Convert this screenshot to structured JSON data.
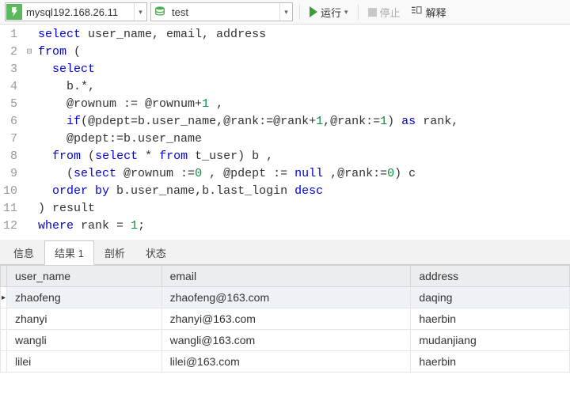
{
  "toolbar": {
    "connection": "mysql192.168.26.11",
    "database": "test",
    "run_label": "运行",
    "stop_label": "停止",
    "explain_label": "解释"
  },
  "editor": {
    "lines": [
      [
        {
          "t": "select",
          "c": "kw"
        },
        {
          "t": " user_name, email, address",
          "c": ""
        }
      ],
      [
        {
          "t": "from",
          "c": "kw"
        },
        {
          "t": " (",
          "c": ""
        }
      ],
      [
        {
          "t": "  ",
          "c": ""
        },
        {
          "t": "select",
          "c": "kw"
        }
      ],
      [
        {
          "t": "    b.*,",
          "c": ""
        }
      ],
      [
        {
          "t": "    @rownum := @rownum+",
          "c": ""
        },
        {
          "t": "1",
          "c": "num"
        },
        {
          "t": " ,",
          "c": ""
        }
      ],
      [
        {
          "t": "    ",
          "c": ""
        },
        {
          "t": "if",
          "c": "kw"
        },
        {
          "t": "(@pdept=b.user_name,@rank:=@rank+",
          "c": ""
        },
        {
          "t": "1",
          "c": "num"
        },
        {
          "t": ",@rank:=",
          "c": ""
        },
        {
          "t": "1",
          "c": "num"
        },
        {
          "t": ") ",
          "c": ""
        },
        {
          "t": "as",
          "c": "kw"
        },
        {
          "t": " rank,",
          "c": ""
        }
      ],
      [
        {
          "t": "    @pdept:=b.user_name",
          "c": ""
        }
      ],
      [
        {
          "t": "  ",
          "c": ""
        },
        {
          "t": "from",
          "c": "kw"
        },
        {
          "t": " (",
          "c": ""
        },
        {
          "t": "select",
          "c": "kw"
        },
        {
          "t": " * ",
          "c": ""
        },
        {
          "t": "from",
          "c": "kw"
        },
        {
          "t": " t_user) b ,",
          "c": ""
        }
      ],
      [
        {
          "t": "    (",
          "c": ""
        },
        {
          "t": "select",
          "c": "kw"
        },
        {
          "t": " @rownum :=",
          "c": ""
        },
        {
          "t": "0",
          "c": "num"
        },
        {
          "t": " , @pdept := ",
          "c": ""
        },
        {
          "t": "null",
          "c": "kw"
        },
        {
          "t": " ,@rank:=",
          "c": ""
        },
        {
          "t": "0",
          "c": "num"
        },
        {
          "t": ") c",
          "c": ""
        }
      ],
      [
        {
          "t": "  ",
          "c": ""
        },
        {
          "t": "order by",
          "c": "kw"
        },
        {
          "t": " b.user_name,b.last_login ",
          "c": ""
        },
        {
          "t": "desc",
          "c": "kw"
        }
      ],
      [
        {
          "t": ") result",
          "c": ""
        }
      ],
      [
        {
          "t": "where",
          "c": "kw"
        },
        {
          "t": " rank = ",
          "c": ""
        },
        {
          "t": "1",
          "c": "num"
        },
        {
          "t": ";",
          "c": ""
        }
      ]
    ],
    "fold_positions": {
      "2": "⊟"
    }
  },
  "tabs": {
    "items": [
      "信息",
      "结果 1",
      "剖析",
      "状态"
    ],
    "active_index": 1
  },
  "results": {
    "columns": [
      "user_name",
      "email",
      "address"
    ],
    "rows": [
      {
        "user_name": "zhaofeng",
        "email": "zhaofeng@163.com",
        "address": "daqing"
      },
      {
        "user_name": "zhanyi",
        "email": "zhanyi@163.com",
        "address": "haerbin"
      },
      {
        "user_name": "wangli",
        "email": "wangli@163.com",
        "address": "mudanjiang"
      },
      {
        "user_name": "lilei",
        "email": "lilei@163.com",
        "address": "haerbin"
      }
    ],
    "selected_row": 0
  }
}
